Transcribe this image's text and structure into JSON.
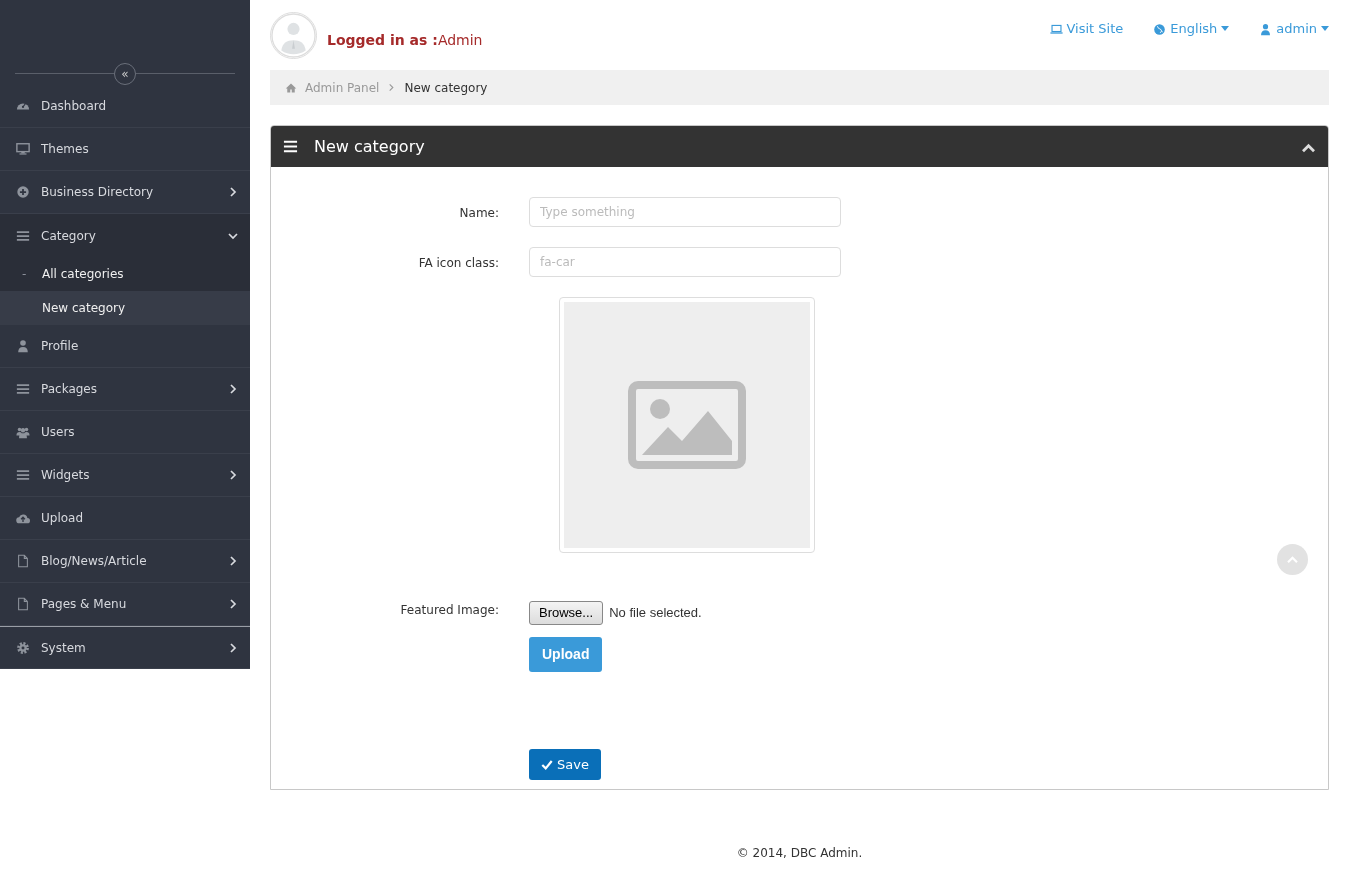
{
  "sidebar": {
    "collapse_button": "«",
    "items": [
      {
        "label": "Dashboard",
        "kind": "dashboard",
        "submenu": false,
        "expanded": false
      },
      {
        "label": "Themes",
        "kind": "monitor",
        "submenu": false,
        "expanded": false
      },
      {
        "label": "Business Directory",
        "kind": "plus",
        "submenu": true,
        "expanded": false
      },
      {
        "label": "Category",
        "kind": "list",
        "submenu": true,
        "expanded": true,
        "children": [
          {
            "marker": "-",
            "label": "All categories",
            "selected": false
          },
          {
            "label": "New category",
            "selected": true
          }
        ]
      },
      {
        "label": "Profile",
        "kind": "user",
        "submenu": false,
        "expanded": false
      },
      {
        "label": "Packages",
        "kind": "list",
        "submenu": true,
        "expanded": false
      },
      {
        "label": "Users",
        "kind": "users",
        "submenu": false,
        "expanded": false
      },
      {
        "label": "Widgets",
        "kind": "list",
        "submenu": true,
        "expanded": false
      },
      {
        "label": "Upload",
        "kind": "upload",
        "submenu": false,
        "expanded": false
      },
      {
        "label": "Blog/News/Article",
        "kind": "file",
        "submenu": true,
        "expanded": false
      },
      {
        "label": "Pages & Menu",
        "kind": "file",
        "submenu": true,
        "expanded": false
      },
      {
        "label": "System",
        "kind": "gear",
        "submenu": true,
        "expanded": false
      }
    ]
  },
  "header": {
    "logged_in": "**Logged in as :**Admin",
    "links": [
      {
        "label": "Visit Site",
        "kind": "site",
        "dropdown": false
      },
      {
        "label": "English",
        "kind": "language",
        "dropdown": true
      },
      {
        "label": "admin",
        "kind": "account",
        "dropdown": true
      }
    ]
  },
  "breadcrumb": [
    {
      "label": "Admin Panel",
      "current": false
    },
    {
      "label": "New category",
      "current": true
    }
  ],
  "panel": {
    "title": "New category",
    "fields": [
      {
        "label": "Name:",
        "placeholder": "Type something"
      },
      {
        "label": "FA icon class:",
        "placeholder": "fa-car"
      }
    ],
    "featured_image": {
      "label": "Featured Image:",
      "browse": "Browse...",
      "file_status": "No file selected.",
      "upload": "Upload"
    },
    "save": "Save"
  },
  "footer": "© 2014, DBC Admin."
}
